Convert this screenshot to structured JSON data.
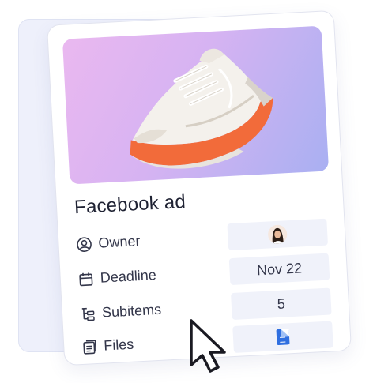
{
  "card": {
    "title": "Facebook ad",
    "image": {
      "subject": "sneaker",
      "gradient_colors": [
        "#eab8f0",
        "#a9b0f2"
      ],
      "shoe_accent": "#f26b3a"
    }
  },
  "fields": [
    {
      "label": "Owner",
      "icon": "person-circle-icon",
      "value_type": "avatar"
    },
    {
      "label": "Deadline",
      "icon": "calendar-icon",
      "value": "Nov 22"
    },
    {
      "label": "Subitems",
      "icon": "subitems-tree-icon",
      "value": "5"
    },
    {
      "label": "Files",
      "icon": "files-icon",
      "value_type": "file",
      "file_icon": "doc-file-icon",
      "file_color": "#2f6fe0"
    }
  ],
  "cursor": {
    "icon": "pointer-cursor-icon"
  }
}
